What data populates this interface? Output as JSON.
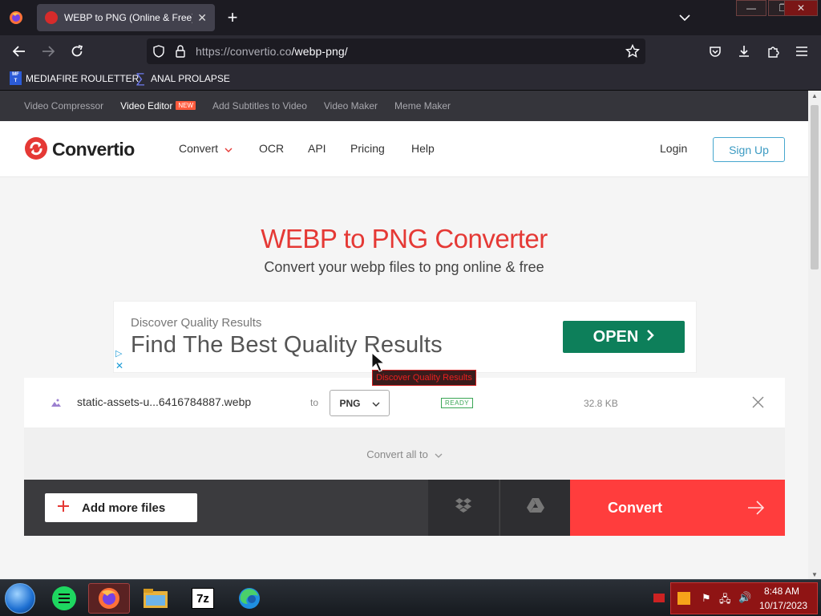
{
  "browser": {
    "tab_title": "WEBP to PNG (Online & Free) –",
    "url_host": "https://convertio.co",
    "url_path": "/webp-png/",
    "bookmarks": [
      {
        "label": "MEDIAFIRE ROULETTER",
        "icon": "mediafire-bookmark-icon"
      },
      {
        "label": "ANAL PROLAPSE",
        "icon": "sigma-bookmark-icon"
      }
    ]
  },
  "site": {
    "toplinks": [
      "Video Compressor",
      "Video Editor",
      "Add Subtitles to Video",
      "Video Maker",
      "Meme Maker"
    ],
    "new_badge": "NEW",
    "logo": "Convertio",
    "nav": {
      "convert": "Convert",
      "ocr": "OCR",
      "api": "API",
      "pricing": "Pricing",
      "help": "Help"
    },
    "login": "Login",
    "signup": "Sign Up"
  },
  "hero": {
    "title": "WEBP to PNG Converter",
    "subtitle": "Convert your webp files to png online & free"
  },
  "ad": {
    "small": "Discover Quality Results",
    "big": "Find The Best Quality Results",
    "button": "OPEN",
    "tooltip": "Discover Quality Results"
  },
  "file": {
    "name": "static-assets-u...6416784887.webp",
    "to": "to",
    "format": "PNG",
    "status": "READY",
    "size": "32.8 KB"
  },
  "convert_all": "Convert all to",
  "actions": {
    "add_more": "Add more files",
    "convert": "Convert"
  },
  "taskbar": {
    "time": "8:48 AM",
    "date": "10/17/2023",
    "apps": [
      "start-orb",
      "notes-app",
      "firefox",
      "file-explorer",
      "7zip",
      "edge"
    ]
  },
  "colors": {
    "brand_red": "#e53935",
    "convert_red": "#ff3d3d",
    "signup_blue": "#3b9ac2",
    "ad_green": "#0d7f5a"
  }
}
